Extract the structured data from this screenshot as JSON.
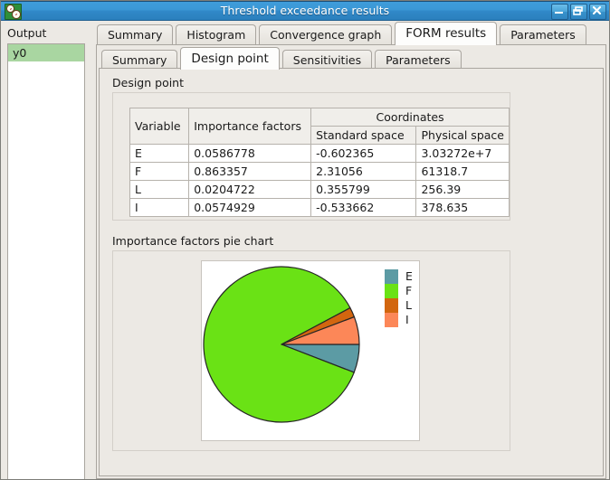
{
  "window": {
    "title": "Threshold exceedance results",
    "icon": "app-gauge-icon",
    "controls": {
      "minimize": "Minimize",
      "restore": "Restore",
      "close": "Close"
    }
  },
  "sidebar": {
    "label": "Output",
    "items": [
      {
        "label": "y0",
        "selected": true
      }
    ]
  },
  "outer_tabs": [
    {
      "label": "Summary",
      "active": false
    },
    {
      "label": "Histogram",
      "active": false
    },
    {
      "label": "Convergence graph",
      "active": false
    },
    {
      "label": "FORM results",
      "active": true
    },
    {
      "label": "Parameters",
      "active": false
    }
  ],
  "inner_tabs": [
    {
      "label": "Summary",
      "active": false
    },
    {
      "label": "Design point",
      "active": true
    },
    {
      "label": "Sensitivities",
      "active": false
    },
    {
      "label": "Parameters",
      "active": false
    }
  ],
  "design_point": {
    "group_title": "Design point",
    "headers": {
      "variable": "Variable",
      "importance_factors": "Importance factors",
      "coordinates": "Coordinates",
      "standard_space": "Standard space",
      "physical_space": "Physical space"
    },
    "rows": [
      {
        "variable": "E",
        "importance": "0.0586778",
        "standard": "-0.602365",
        "physical": "3.03272e+7"
      },
      {
        "variable": "F",
        "importance": "0.863357",
        "standard": "2.31056",
        "physical": "61318.7"
      },
      {
        "variable": "L",
        "importance": "0.0204722",
        "standard": "0.355799",
        "physical": "256.39"
      },
      {
        "variable": "I",
        "importance": "0.0574929",
        "standard": "-0.533662",
        "physical": "378.635"
      }
    ]
  },
  "pie_section": {
    "group_title": "Importance factors pie chart"
  },
  "chart_data": {
    "type": "pie",
    "title": "Importance factors pie chart",
    "labels": [
      "E",
      "F",
      "L",
      "I"
    ],
    "values": [
      0.0586778,
      0.863357,
      0.0204722,
      0.0574929
    ],
    "colors": [
      "#5c9ba4",
      "#6ae215",
      "#d2660f",
      "#fc8758"
    ],
    "legend_position": "right",
    "start_angle_deg": 0,
    "direction": "clockwise",
    "stroke": "#262626",
    "background": "#ffffff"
  }
}
